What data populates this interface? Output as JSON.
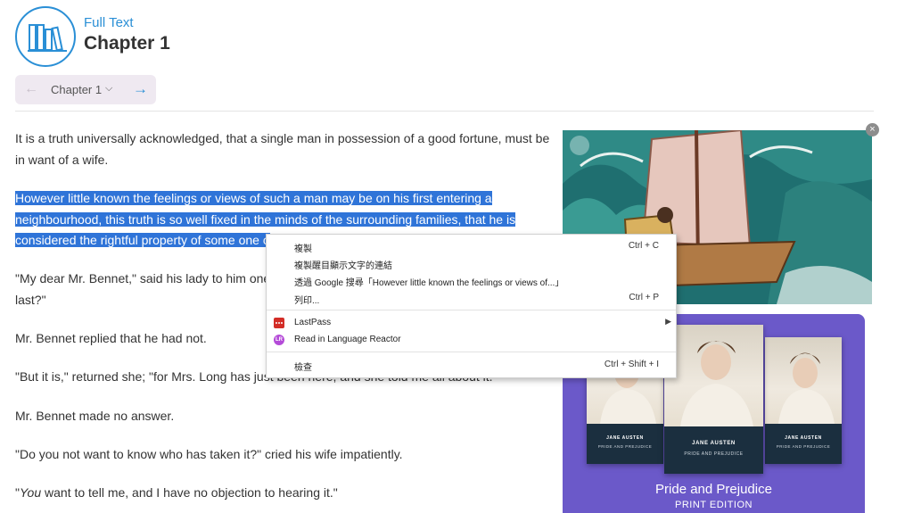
{
  "header": {
    "kicker": "Full Text",
    "title": "Chapter 1",
    "nav": {
      "current_chapter": "Chapter 1"
    }
  },
  "paragraphs": [
    {
      "segments": [
        {
          "text": "It is a truth universally acknowledged, that a single man in possession of a good fortune, must be in want of a wife.",
          "highlighted": false
        }
      ]
    },
    {
      "segments": [
        {
          "text": "However little known the feelings or views of such a man may be on his first entering a neighbourhood, this truth is so well fixed in the minds of the surrounding families, that he is considered the rightful property of some one o",
          "highlighted": true
        }
      ]
    },
    {
      "segments": [
        {
          "text": "\"My dear Mr. Bennet,\" said his lady to him one d",
          "highlighted": false
        }
      ],
      "line2": "last?\""
    },
    {
      "segments": [
        {
          "text": "Mr. Bennet replied that he had not.",
          "highlighted": false
        }
      ]
    },
    {
      "segments": [
        {
          "text": "\"But it is,\" returned she; \"for Mrs. Long has just been here, and she told me all about it.\"",
          "highlighted": false
        }
      ]
    },
    {
      "segments": [
        {
          "text": "Mr. Bennet made no answer.",
          "highlighted": false
        }
      ]
    },
    {
      "segments": [
        {
          "text": "\"Do you not want to know who has taken it?\" cried his wife impatiently.",
          "highlighted": false
        }
      ]
    },
    {
      "italic": "You",
      "rest": " want to tell me, and I have no objection to hearing it.\"",
      "lead": "\""
    }
  ],
  "context_menu": {
    "items": [
      {
        "label": "複製",
        "shortcut": "Ctrl + C"
      },
      {
        "label": "複製醒目顯示文字的連結",
        "shortcut": ""
      },
      {
        "label": "透過 Google 搜尋「However little known the feelings or views of...」",
        "shortcut": ""
      },
      {
        "label": "列印...",
        "shortcut": "Ctrl + P"
      },
      {
        "label": "LastPass",
        "shortcut": "",
        "submenu": true
      },
      {
        "label": "Read in Language Reactor",
        "shortcut": ""
      },
      {
        "label": "檢查",
        "shortcut": "Ctrl + Shift + I"
      }
    ]
  },
  "ad": {
    "title": "Pride and Prejudice",
    "subtitle": "PRINT EDITION",
    "book_author": "JANE AUSTEN",
    "book_title": "PRIDE AND PREJUDICE",
    "color": "#6b59c9"
  },
  "colors": {
    "accent": "#2a8fd6",
    "selection": "#2f74d8"
  }
}
